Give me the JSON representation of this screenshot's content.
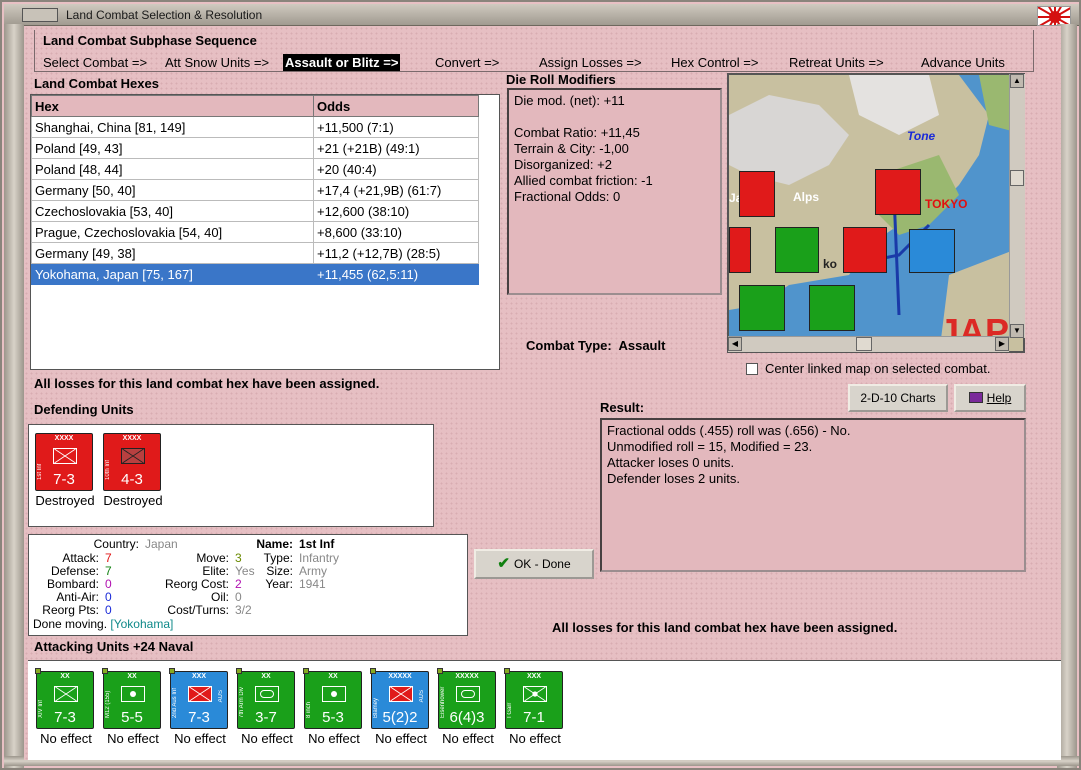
{
  "window": {
    "title": "Land Combat Selection & Resolution"
  },
  "subphase": {
    "title": "Land Combat Subphase Sequence",
    "steps": [
      "Select Combat =>",
      "Att Snow Units =>",
      "Assault or Blitz =>",
      "Convert =>",
      "Assign Losses =>",
      "Hex Control =>",
      "Retreat Units =>",
      "Advance Units"
    ],
    "active_step": "Assault or Blitz =>"
  },
  "hexes": {
    "title": "Land Combat Hexes",
    "columns": [
      "Hex",
      "Odds"
    ],
    "rows": [
      [
        "Shanghai, China [81, 149]",
        "+11,500 (7:1)"
      ],
      [
        "Poland [49, 43]",
        "+21 (+21B) (49:1)"
      ],
      [
        "Poland [48, 44]",
        "+20 (40:4)"
      ],
      [
        "Germany [50, 40]",
        "+17,4 (+21,9B) (61:7)"
      ],
      [
        "Czechoslovakia [53, 40]",
        "+12,600 (38:10)"
      ],
      [
        "Prague, Czechoslovakia [54, 40]",
        "+8,600 (33:10)"
      ],
      [
        "Germany [49, 38]",
        "+11,2 (+12,7B) (28:5)"
      ],
      [
        "Yokohama, Japan [75, 167]",
        "+11,455 (62,5:11)"
      ]
    ],
    "selected_row": 7
  },
  "die_roll": {
    "title": "Die Roll Modifiers",
    "lines": [
      "Die mod. (net): +11",
      "",
      "Combat Ratio: +11,45",
      "Terrain & City: -1,00",
      "Disorganized: +2",
      "Allied combat friction: -1",
      "Fractional Odds: 0"
    ]
  },
  "combat_type": {
    "label": "Combat Type:",
    "value": "Assault"
  },
  "map": {
    "labels": [
      "Tone",
      "Alps",
      "TOKYO",
      "JAP",
      "Ja",
      "Jo",
      "ko"
    ],
    "center_checkbox_label": "Center linked map on selected combat.",
    "center_checked": false
  },
  "losses_msg": "All losses for this land combat hex have been assigned.",
  "buttons": {
    "charts": "2-D-10 Charts",
    "help": "Help",
    "ok": "OK - Done"
  },
  "result": {
    "title": "Result:",
    "lines": [
      "Fractional odds (.455) roll was (.656)  -  No.",
      "Unmodified roll = 15, Modified = 23.",
      "Attacker loses 0 units.",
      "Defender loses 2 units."
    ]
  },
  "defending": {
    "title": "Defending Units",
    "units": [
      {
        "size": "XXXX",
        "name": "1st Inf",
        "strength": "7-3",
        "status": "Destroyed",
        "color": "#e01a1a"
      },
      {
        "size": "XXXX",
        "name": "10th Inf",
        "strength": "4-3",
        "status": "Destroyed",
        "color": "#e01a1a"
      }
    ]
  },
  "unit_info": {
    "country_label": "Country:",
    "country": "Japan",
    "attack_label": "Attack:",
    "attack": "7",
    "defense_label": "Defense:",
    "defense": "7",
    "bombard_label": "Bombard:",
    "bombard": "0",
    "antiair_label": "Anti-Air:",
    "antiair": "0",
    "reorgpts_label": "Reorg Pts:",
    "reorgpts": "0",
    "move_label": "Move:",
    "move": "3",
    "elite_label": "Elite:",
    "elite": "Yes",
    "reorgcost_label": "Reorg Cost:",
    "reorgcost": "2",
    "oil_label": "Oil:",
    "oil": "0",
    "costturns_label": "Cost/Turns:",
    "costturns": "3/2",
    "name_label": "Name:",
    "name": "1st Inf",
    "type_label": "Type:",
    "type": "Infantry",
    "size_label": "Size:",
    "size": "Army",
    "year_label": "Year:",
    "year": "1941",
    "done_moving": "Done moving.",
    "location": "[Yokohama]"
  },
  "attacking": {
    "title": "Attacking Units +24 Naval",
    "units": [
      {
        "size": "XX",
        "name": "XIV Inf",
        "strength": "7-3",
        "status": "No effect",
        "color": "#1aa01a",
        "flag": ""
      },
      {
        "size": "XX",
        "name": "M12 (155)",
        "strength": "5-5",
        "status": "No effect",
        "color": "#1aa01a",
        "flag": ""
      },
      {
        "size": "XXX",
        "name": "2nd Aus Inf",
        "strength": "7-3",
        "status": "No effect",
        "color": "#2a8ad8",
        "flag": "AUS"
      },
      {
        "size": "XX",
        "name": "7th Arm Div",
        "strength": "3-7",
        "status": "No effect",
        "color": "#1aa01a",
        "flag": ""
      },
      {
        "size": "XX",
        "name": "8 inch",
        "strength": "5-3",
        "status": "No effect",
        "color": "#1aa01a",
        "flag": ""
      },
      {
        "size": "XXXXX",
        "name": "Blamey",
        "strength": "5(2)2",
        "status": "No effect",
        "color": "#2a8ad8",
        "flag": "AUS"
      },
      {
        "size": "XXXXX",
        "name": "Eisenhower",
        "strength": "6(4)3",
        "status": "No effect",
        "color": "#1aa01a",
        "flag": ""
      },
      {
        "size": "XXX",
        "name": "I Garr",
        "strength": "7-1",
        "status": "No effect",
        "color": "#1aa01a",
        "flag": ""
      }
    ]
  }
}
